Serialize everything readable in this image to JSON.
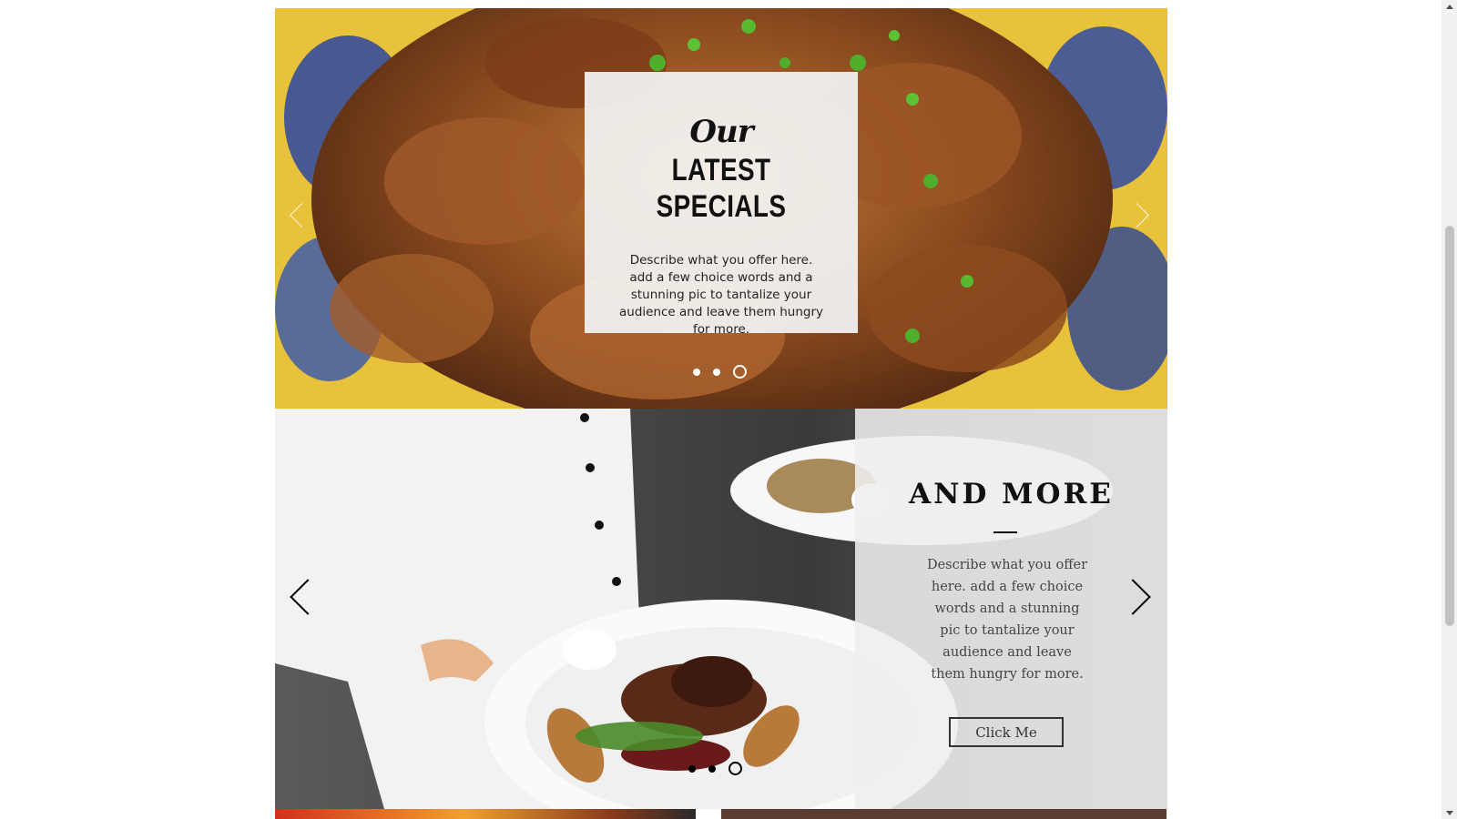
{
  "slideshow_1": {
    "script_heading": "Our",
    "title": "LATEST SPECIALS",
    "description": "Describe what you offer here. add a few choice words and a stunning pic to tantalize your audience and leave them hungry for more.",
    "dots_count": 3,
    "active_dot": 3,
    "prev_icon": "chevron-left-icon",
    "next_icon": "chevron-right-icon"
  },
  "slideshow_2": {
    "title": "AND MORE",
    "description": "Describe what you offer here. add a few choice words and a stunning pic to tantalize your audience and leave them hungry for more.",
    "button_label": "Click Me",
    "dots_count": 3,
    "active_dot": 3,
    "prev_icon": "chevron-left-icon",
    "next_icon": "chevron-right-icon"
  },
  "colors": {
    "text_dark": "#111111",
    "panel_light": "#eeeeee",
    "scrollbar_thumb": "#c1c1c1"
  }
}
